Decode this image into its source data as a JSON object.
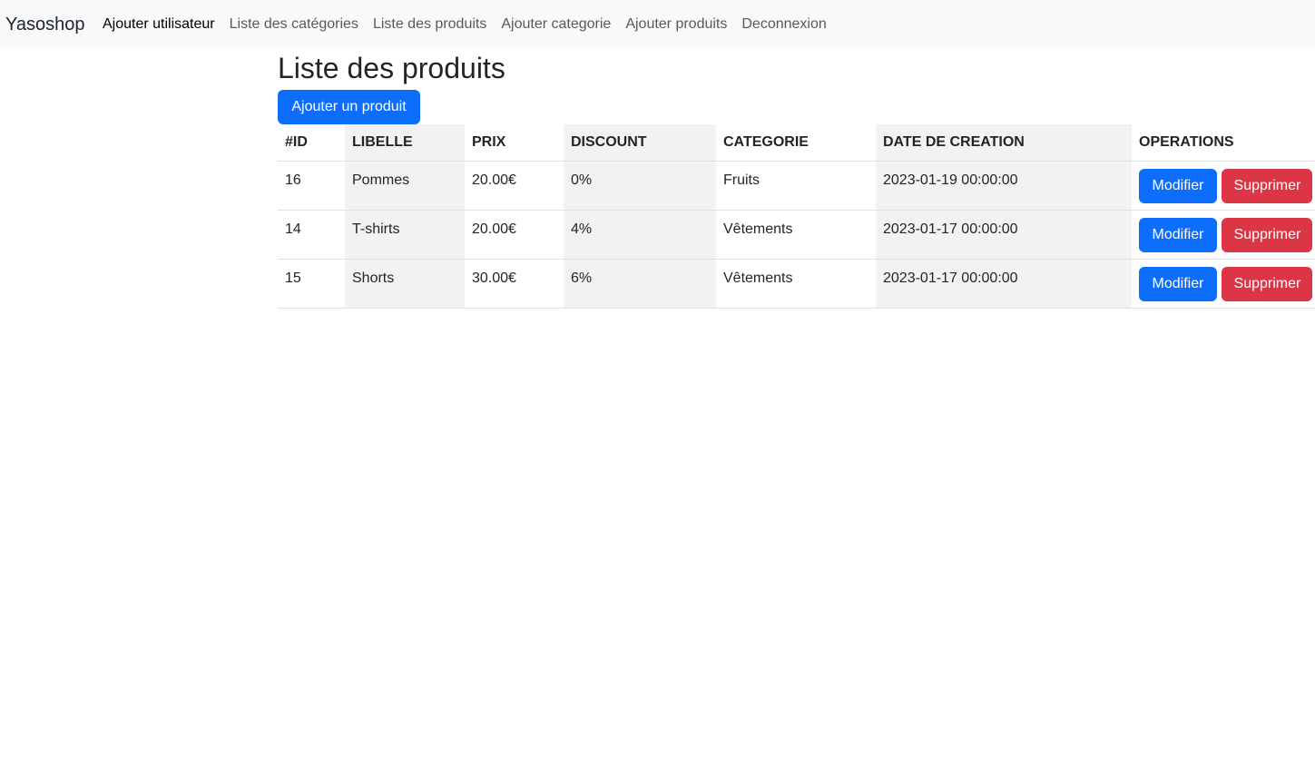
{
  "navbar": {
    "brand": "Yasoshop",
    "links": [
      {
        "label": "Ajouter utilisateur",
        "active": true
      },
      {
        "label": "Liste des catégories",
        "active": false
      },
      {
        "label": "Liste des produits",
        "active": false
      },
      {
        "label": "Ajouter categorie",
        "active": false
      },
      {
        "label": "Ajouter produits",
        "active": false
      },
      {
        "label": "Deconnexion",
        "active": false
      }
    ]
  },
  "main": {
    "title": "Liste des produits",
    "add_button": "Ajouter un produit",
    "table": {
      "headers": [
        "#ID",
        "LIBELLE",
        "PRIX",
        "DISCOUNT",
        "CATEGORIE",
        "DATE DE CREATION",
        "OPERATIONS"
      ],
      "rows": [
        {
          "id": "16",
          "libelle": "Pommes",
          "prix": "20.00€",
          "discount": "0%",
          "categorie": "Fruits",
          "date": "2023-01-19 00:00:00"
        },
        {
          "id": "14",
          "libelle": "T-shirts",
          "prix": "20.00€",
          "discount": "4%",
          "categorie": "Vêtements",
          "date": "2023-01-17 00:00:00"
        },
        {
          "id": "15",
          "libelle": "Shorts",
          "prix": "30.00€",
          "discount": "6%",
          "categorie": "Vêtements",
          "date": "2023-01-17 00:00:00"
        }
      ],
      "edit_label": "Modifier",
      "delete_label": "Supprimer"
    }
  },
  "colors": {
    "primary": "#0d6efd",
    "danger": "#dc3545",
    "navbar_bg": "#f8f9fa",
    "stripe": "#f2f2f2"
  }
}
